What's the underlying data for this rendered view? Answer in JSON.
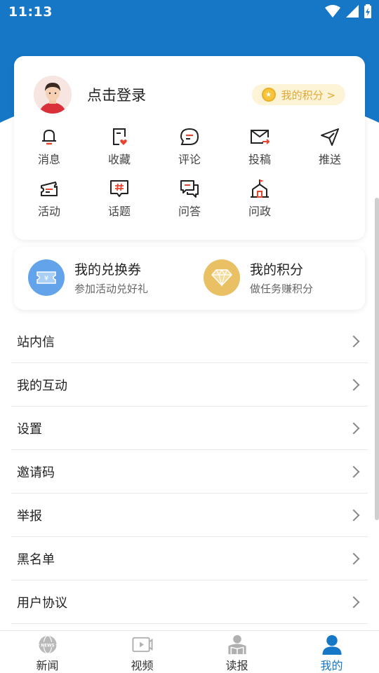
{
  "status_bar": {
    "time": "11:13"
  },
  "profile": {
    "login_text": "点击登录",
    "points_badge": "我的积分 >"
  },
  "icon_grid": {
    "row1": [
      {
        "label": "消息",
        "icon": "bell-icon"
      },
      {
        "label": "收藏",
        "icon": "favorite-icon"
      },
      {
        "label": "评论",
        "icon": "comment-icon"
      },
      {
        "label": "投稿",
        "icon": "mail-send-icon"
      },
      {
        "label": "推送",
        "icon": "send-icon"
      }
    ],
    "row2": [
      {
        "label": "活动",
        "icon": "ticket-icon"
      },
      {
        "label": "话题",
        "icon": "hashtag-icon"
      },
      {
        "label": "问答",
        "icon": "qa-icon"
      },
      {
        "label": "问政",
        "icon": "government-icon"
      }
    ]
  },
  "promos": [
    {
      "title": "我的兑换券",
      "subtitle": "参加活动兑好礼",
      "icon": "coupon-icon",
      "color": "#62a3ea"
    },
    {
      "title": "我的积分",
      "subtitle": "做任务赚积分",
      "icon": "diamond-icon",
      "color": "#e9c063"
    }
  ],
  "menu": [
    {
      "label": "站内信"
    },
    {
      "label": "我的互动"
    },
    {
      "label": "设置"
    },
    {
      "label": "邀请码"
    },
    {
      "label": "举报"
    },
    {
      "label": "黑名单"
    },
    {
      "label": "用户协议"
    }
  ],
  "tabs": [
    {
      "label": "新闻",
      "icon": "news-globe-icon",
      "active": false
    },
    {
      "label": "视频",
      "icon": "video-icon",
      "active": false
    },
    {
      "label": "读报",
      "icon": "reading-icon",
      "active": false
    },
    {
      "label": "我的",
      "icon": "user-icon",
      "active": true
    }
  ],
  "colors": {
    "primary": "#1677c7",
    "accent_red": "#e6452f",
    "gold": "#e2a935"
  }
}
